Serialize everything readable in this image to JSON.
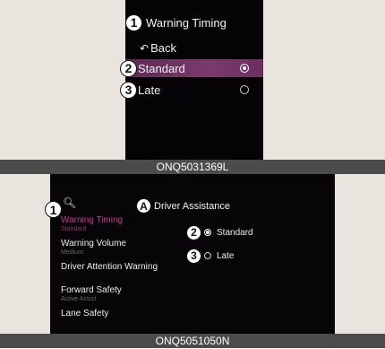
{
  "panel1": {
    "title": "Warning Timing",
    "title_callout": "1",
    "back_label": "Back",
    "options": [
      {
        "callout": "2",
        "label": "Standard",
        "selected": true
      },
      {
        "callout": "3",
        "label": "Late",
        "selected": false
      }
    ],
    "caption": "ONQ5031369L"
  },
  "panel2": {
    "header_title": "Driver Assistance",
    "header_callout": "A",
    "left_callout": "1",
    "menu_items": [
      {
        "label": "Warning Timing",
        "sub": "Standard",
        "active": true
      },
      {
        "label": "Warning Volume",
        "sub": "Medium",
        "active": false
      },
      {
        "label": "Driver Attention Warning",
        "sub": "",
        "active": false
      },
      {
        "label": "Forward Safety",
        "sub": "Active Assist",
        "active": false
      },
      {
        "label": "Lane Safety",
        "sub": "",
        "active": false
      }
    ],
    "options": [
      {
        "callout": "2",
        "label": "Standard",
        "selected": true
      },
      {
        "callout": "3",
        "label": "Late",
        "selected": false
      }
    ],
    "caption": "ONQ5051050N"
  },
  "colors": {
    "accent": "#c23a8a",
    "highlight": "#6b2f5e",
    "screen_bg": "#050306",
    "page_bg": "#e9e4dd",
    "caption_bg": "#4b4b4b"
  },
  "icons": {
    "back": "back-arrow-icon",
    "search": "search-icon"
  }
}
